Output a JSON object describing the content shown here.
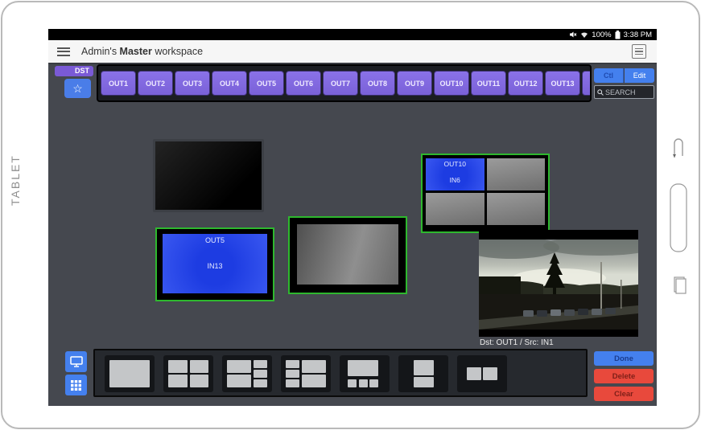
{
  "device": {
    "side_label": "TABLET"
  },
  "status_bar": {
    "battery": "100%",
    "time": "3:38 PM"
  },
  "title_bar": {
    "title_part1": "Admin's ",
    "title_part2": "Master",
    "title_part3": " workspace"
  },
  "output_bar": {
    "dst_label": "DST",
    "outputs": [
      "OUT1",
      "OUT2",
      "OUT3",
      "OUT4",
      "OUT5",
      "OUT6",
      "OUT7",
      "OUT8",
      "OUT9",
      "OUT10",
      "OUT11",
      "OUT12",
      "OUT13"
    ],
    "ctl_label": "Ctl",
    "edit_label": "Edit",
    "search_placeholder": "SEARCH"
  },
  "canvas": {
    "monitors": {
      "out10": {
        "output": "OUT10",
        "input": "IN6"
      },
      "out5": {
        "output": "OUT5",
        "input": "IN13"
      }
    },
    "preview_caption": "Dst: OUT1 / Src: IN1"
  },
  "toolbar": {
    "done_label": "Done",
    "delete_label": "Delete",
    "clear_label": "Clear",
    "presets": [
      {
        "name": "single",
        "cells": [
          [
            0,
            0,
            100,
            100
          ]
        ]
      },
      {
        "name": "quad",
        "cells": [
          [
            0,
            0,
            47,
            47
          ],
          [
            53,
            0,
            47,
            47
          ],
          [
            0,
            53,
            47,
            47
          ],
          [
            53,
            53,
            47,
            47
          ]
        ]
      },
      {
        "name": "two-left-three-right",
        "cells": [
          [
            0,
            0,
            60,
            47
          ],
          [
            0,
            53,
            60,
            47
          ],
          [
            66,
            0,
            34,
            29
          ],
          [
            66,
            35,
            34,
            29
          ],
          [
            66,
            71,
            34,
            29
          ]
        ]
      },
      {
        "name": "three-left-two-right",
        "cells": [
          [
            0,
            0,
            34,
            29
          ],
          [
            0,
            35,
            34,
            29
          ],
          [
            0,
            71,
            34,
            29
          ],
          [
            40,
            0,
            60,
            47
          ],
          [
            40,
            53,
            60,
            47
          ]
        ]
      },
      {
        "name": "one-top-three-bottom",
        "cells": [
          [
            8,
            0,
            76,
            60
          ],
          [
            8,
            70,
            22,
            30
          ],
          [
            35,
            70,
            22,
            30
          ],
          [
            62,
            70,
            22,
            30
          ]
        ]
      },
      {
        "name": "two-vertical",
        "cells": [
          [
            25,
            0,
            50,
            55
          ],
          [
            25,
            62,
            50,
            38
          ]
        ]
      },
      {
        "name": "two-horizontal",
        "cells": [
          [
            12,
            26,
            36,
            48
          ],
          [
            52,
            26,
            36,
            48
          ]
        ]
      }
    ]
  },
  "colors": {
    "accent_blue": "#4480ee",
    "accent_purple": "#8169e0",
    "accent_red": "#e8493c",
    "monitor_select_green": "#2eb82e",
    "active_route_blue": "#2445e8",
    "app_background": "#45484f"
  }
}
